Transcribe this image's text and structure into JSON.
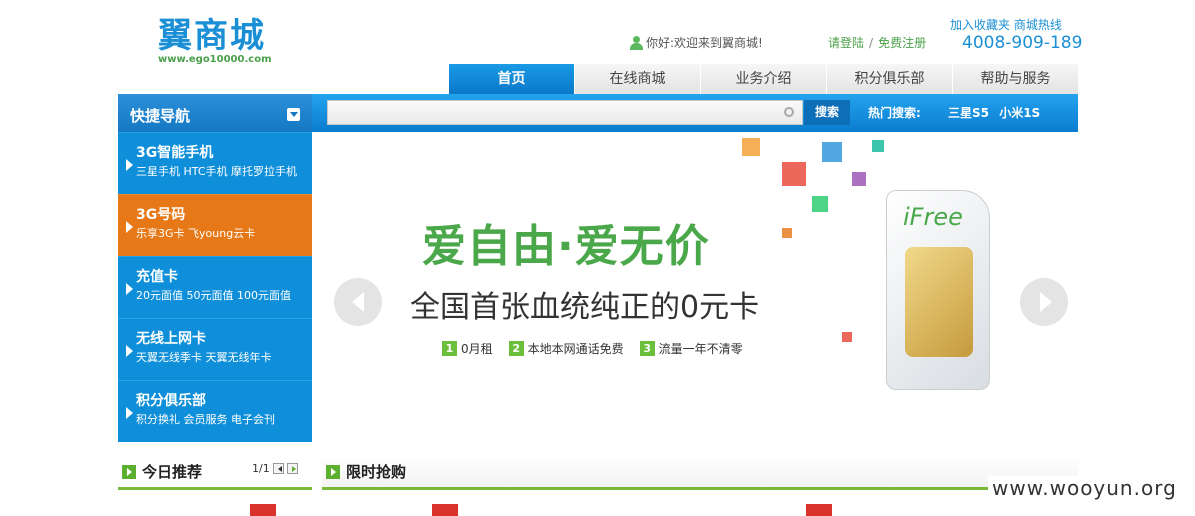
{
  "header": {
    "logo_name": "翼商城",
    "logo_url": "www.ego10000.com",
    "welcome": "你好:欢迎来到翼商城!",
    "login": "请登陆",
    "separator": "/",
    "register": "免费注册",
    "bookmark": "加入收藏夹",
    "hotline_label": "商城热线",
    "hotline_number": "4008-909-189"
  },
  "nav": {
    "tabs": [
      {
        "label": "首页"
      },
      {
        "label": "在线商城"
      },
      {
        "label": "业务介绍"
      },
      {
        "label": "积分俱乐部"
      },
      {
        "label": "帮助与服务"
      }
    ]
  },
  "quicknav": {
    "title": "快捷导航",
    "items": [
      {
        "title": "3G智能手机",
        "sub": "三星手机 HTC手机 摩托罗拉手机"
      },
      {
        "title": "3G号码",
        "sub": "乐享3G卡 飞young云卡"
      },
      {
        "title": "充值卡",
        "sub": "20元面值 50元面值 100元面值"
      },
      {
        "title": "无线上网卡",
        "sub": "天翼无线季卡 天翼无线年卡"
      },
      {
        "title": "积分俱乐部",
        "sub": "积分换礼 会员服务 电子会刊"
      }
    ]
  },
  "search": {
    "button": "搜索",
    "hot_label": "热门搜索:",
    "hot_items": [
      "三星S5",
      "小米1S"
    ]
  },
  "banner": {
    "slogan": "爱自由·爱无价",
    "subslogan": "全国首张血统纯正的0元卡",
    "features": [
      {
        "num": "1",
        "text": "0月租"
      },
      {
        "num": "2",
        "text": "本地本网通话免费"
      },
      {
        "num": "3",
        "text": "流量一年不清零"
      }
    ],
    "sim_brand": "iFree"
  },
  "sections": {
    "today": "今日推荐",
    "pager": "1/1",
    "flash": "限时抢购"
  },
  "watermark": "www.wooyun.org",
  "colors": {
    "brand_blue": "#1a8fd6",
    "nav_active": "#0a78c8",
    "side_active": "#e67817",
    "green": "#4aa84a"
  }
}
